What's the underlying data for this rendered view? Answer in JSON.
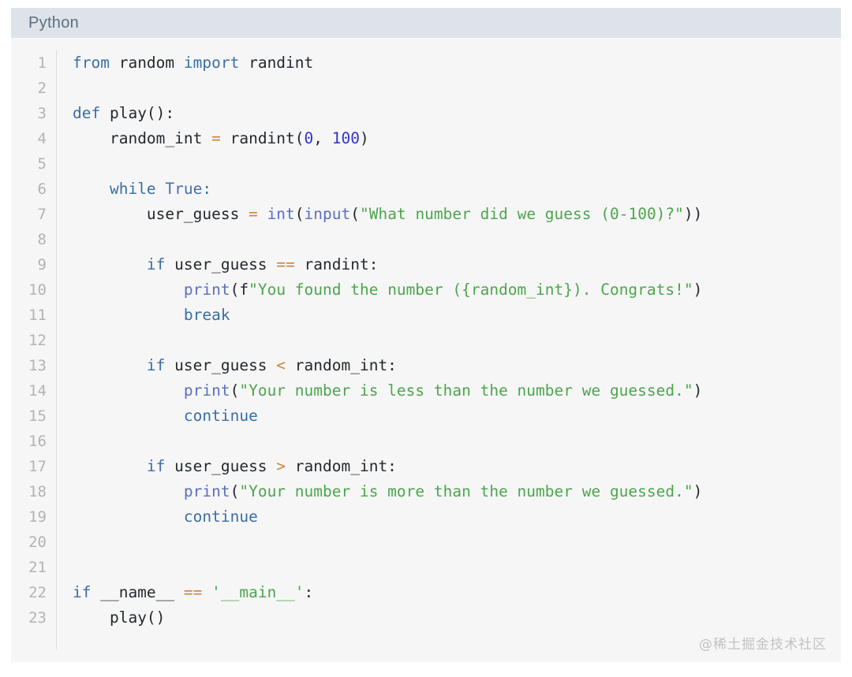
{
  "header": {
    "language_label": "Python"
  },
  "colors": {
    "header_bg": "#dde3e9",
    "header_text": "#5d6f80",
    "code_bg": "#f6f6f7",
    "gutter_text": "#b3b3b3",
    "keyword": "#3a6ea5",
    "function": "#5b6fc0",
    "string": "#4ca64c",
    "number": "#3333cc",
    "operator": "#c9853f",
    "plain": "#24292e",
    "watermark": "#c2c2c2"
  },
  "editor": {
    "line_numbers": [
      "1",
      "2",
      "3",
      "4",
      "5",
      "6",
      "7",
      "8",
      "9",
      "10",
      "11",
      "12",
      "13",
      "14",
      "15",
      "16",
      "17",
      "18",
      "19",
      "20",
      "21",
      "22",
      "23"
    ],
    "lines": [
      "from random import randint",
      "",
      "def play():",
      "    random_int = randint(0, 100)",
      "",
      "    while True:",
      "        user_guess = int(input(\"What number did we guess (0-100)?\"))",
      "",
      "        if user_guess == randint:",
      "            print(f\"You found the number ({random_int}). Congrats!\")",
      "            break",
      "",
      "        if user_guess < random_int:",
      "            print(\"Your number is less than the number we guessed.\")",
      "            continue",
      "",
      "        if user_guess > random_int:",
      "            print(\"Your number is more than the number we guessed.\")",
      "            continue",
      "",
      "",
      "if __name__ == '__main__':",
      "    play()"
    ],
    "tokens": {
      "l1_from": "from",
      "l1_random": " random ",
      "l1_import": "import",
      "l1_randint": " randint",
      "l3_def": "def",
      "l3_rest": " play():",
      "l4_indent": "    ",
      "l4_var": "random_int ",
      "l4_eq": "=",
      "l4_call": " randint(",
      "l4_zero": "0",
      "l4_comma": ", ",
      "l4_hundred": "100",
      "l4_close": ")",
      "l6_indent": "    ",
      "l6_while": "while",
      "l6_true": " True",
      "l6_colon": ":",
      "l7_indent": "        ",
      "l7_var": "user_guess ",
      "l7_eq": "=",
      "l7_sp": " ",
      "l7_int": "int",
      "l7_p1": "(",
      "l7_input": "input",
      "l7_p2": "(",
      "l7_str": "\"What number did we guess (0-100)?\"",
      "l7_end": "))",
      "l9_indent": "        ",
      "l9_if": "if",
      "l9_var": " user_guess ",
      "l9_eqeq": "==",
      "l9_rest": " randint:",
      "l10_indent": "            ",
      "l10_print": "print",
      "l10_p": "(",
      "l10_f": "f",
      "l10_str": "\"You found the number ({random_int}). Congrats!\"",
      "l10_end": ")",
      "l11_indent": "            ",
      "l11_break": "break",
      "l13_indent": "        ",
      "l13_if": "if",
      "l13_var": " user_guess ",
      "l13_lt": "<",
      "l13_rest": " random_int:",
      "l14_indent": "            ",
      "l14_print": "print",
      "l14_p": "(",
      "l14_str": "\"Your number is less than the number we guessed.\"",
      "l14_end": ")",
      "l15_indent": "            ",
      "l15_continue": "continue",
      "l17_indent": "        ",
      "l17_if": "if",
      "l17_var": " user_guess ",
      "l17_gt": ">",
      "l17_rest": " random_int:",
      "l18_indent": "            ",
      "l18_print": "print",
      "l18_p": "(",
      "l18_str": "\"Your number is more than the number we guessed.\"",
      "l18_end": ")",
      "l19_indent": "            ",
      "l19_continue": "continue",
      "l22_if": "if",
      "l22_name": " __name__ ",
      "l22_eqeq": "==",
      "l22_sp": " ",
      "l22_main": "'__main__'",
      "l22_colon": ":",
      "l23_indent": "    ",
      "l23_call": "play()"
    }
  },
  "watermark": {
    "text": "@稀土掘金技术社区"
  }
}
